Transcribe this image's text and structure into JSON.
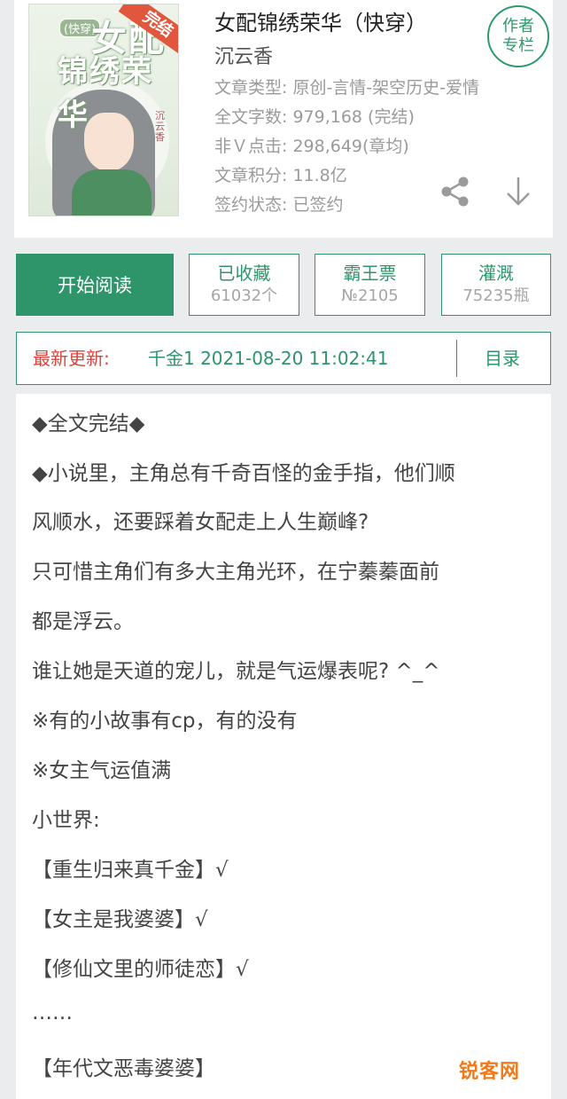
{
  "book": {
    "title": "女配锦绣荣华（快穿）",
    "author": "沉云香",
    "meta": [
      "文章类型: 原创-言情-架空历史-爱情",
      "全文字数: 979,168 (完结)",
      "非Ｖ点击: 298,649(章均)",
      "文章积分: 11.8亿",
      "签约状态:  已签约"
    ],
    "author_column_line1": "作者",
    "author_column_line2": "专栏"
  },
  "cover": {
    "tag": "(快穿)",
    "title_line1": "女配",
    "title_line2": "锦绣荣华",
    "ribbon": "完结",
    "signature": "沉云香"
  },
  "actions": {
    "read_label": "开始阅读",
    "favorite_label": "已收藏",
    "favorite_count": "61032个",
    "ticket_label": "霸王票",
    "ticket_rank": "№2105",
    "nutrient_label": "灌溉",
    "nutrient_count": "75235瓶"
  },
  "update": {
    "label": "最新更新:",
    "chapter": "千金1  2021-08-20 11:02:41",
    "toc_label": "目录"
  },
  "synopsis": [
    "◆全文完结◆",
    "◆小说里，主角总有千奇百怪的金手指，他们顺",
    "风顺水，还要踩着女配走上人生巅峰?",
    "  只可惜主角们有多大主角光环，在宁蓁蓁面前",
    "都是浮云。",
    "  谁让她是天道的宠儿，就是气运爆表呢? ^_^",
    "  ※有的小故事有cp，有的没有",
    "  ※女主气运值满",
    "   小世界:",
    "  【重生归来真千金】√",
    "  【女主是我婆婆】√",
    "  【修仙文里的师徒恋】√",
    "  ……",
    "  【年代文恶毒婆婆】"
  ],
  "watermark": "锐客网",
  "colors": {
    "accent": "#2e946a",
    "update_label": "#d9443b",
    "background": "#ebeced",
    "watermark": "#f07a1a"
  },
  "icons": {
    "share": "share-icon",
    "download": "download-icon"
  }
}
